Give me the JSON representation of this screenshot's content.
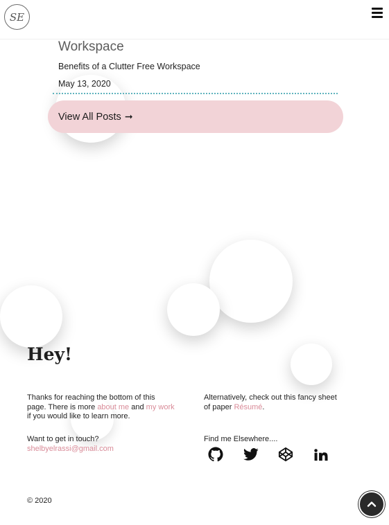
{
  "header": {
    "logo_text": "SE"
  },
  "posts": {
    "title": "Workspace",
    "subtitle": "Benefits of a Clutter Free Workspace",
    "date": "May 13, 2020",
    "view_all_label": "View All Posts",
    "view_all_arrow": "➞"
  },
  "footer": {
    "heading": "Hey!",
    "left_para1": {
      "pre": "Thanks for reaching the bottom of this page. There is more",
      "link1": "about me",
      "mid": "and",
      "link2": "my work",
      "post": "if you would like to learn more."
    },
    "left_para2": {
      "text": "Want to get in touch?",
      "email": "shelbyelrassi@gmail.com"
    },
    "right_para1": {
      "pre": "Alternatively, check out this fancy sheet of paper",
      "link": "Résumé",
      "post": "."
    },
    "right_para2": {
      "text": "Find me Elsewhere...."
    },
    "social_icons": [
      "github-icon",
      "twitter-icon",
      "codepen-icon",
      "linkedin-icon"
    ],
    "copyright": "© 2020"
  },
  "colors": {
    "accent_pink": "#f2d3d7",
    "link_pink": "#d98b98",
    "divider_teal": "#5fb3bd",
    "dark": "#2a2a2a"
  }
}
